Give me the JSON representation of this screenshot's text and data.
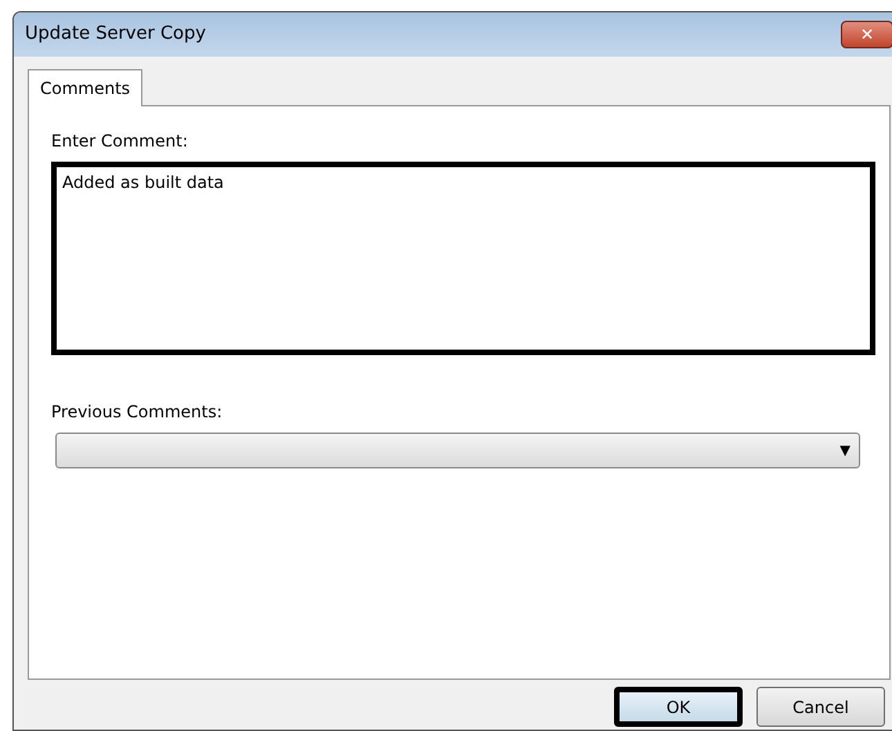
{
  "window": {
    "title": "Update Server Copy",
    "close_glyph": "✕"
  },
  "tabs": [
    {
      "label": "Comments",
      "selected": true
    }
  ],
  "comment": {
    "label": "Enter Comment:",
    "value": "Added as built data",
    "highlighted": true
  },
  "previous_comments": {
    "label": "Previous Comments:",
    "arrow": "▼"
  },
  "buttons": [
    {
      "label": "OK",
      "highlighted": true
    },
    {
      "label": "Cancel",
      "highlighted": false
    }
  ]
}
